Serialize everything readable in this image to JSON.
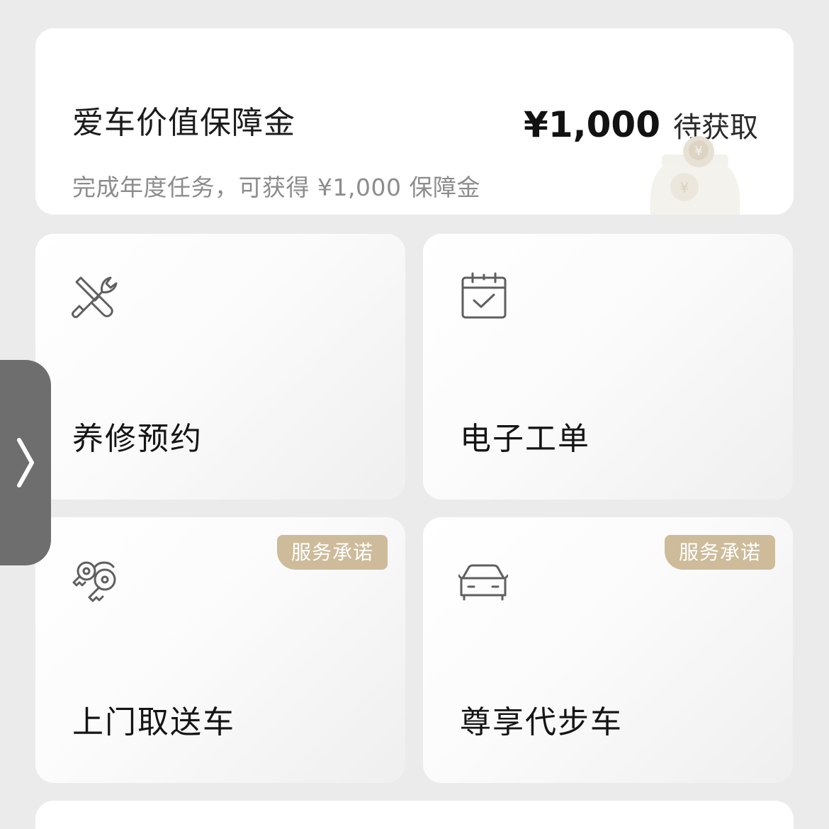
{
  "banner": {
    "title": "爱车价值保障金",
    "amount": "¥1,000",
    "status": "待获取",
    "description": "完成年度任务，可获得 ¥1,000 保障金",
    "decoration_icon": "coin-jar-icon"
  },
  "services": [
    {
      "label": "养修预约",
      "icon": "wrench-screwdriver-icon",
      "badge": ""
    },
    {
      "label": "电子工单",
      "icon": "calendar-check-icon",
      "badge": ""
    },
    {
      "label": "上门取送车",
      "icon": "car-keys-icon",
      "badge": "服务承诺"
    },
    {
      "label": "尊享代步车",
      "icon": "car-front-icon",
      "badge": "服务承诺"
    }
  ],
  "side_handle": {
    "icon": "chevron-right-icon"
  },
  "colors": {
    "background": "#ebebeb",
    "card": "#ffffff",
    "badge": "#cdbb9a",
    "handle": "#6e6e6e",
    "muted_text": "#8c8c8c"
  }
}
